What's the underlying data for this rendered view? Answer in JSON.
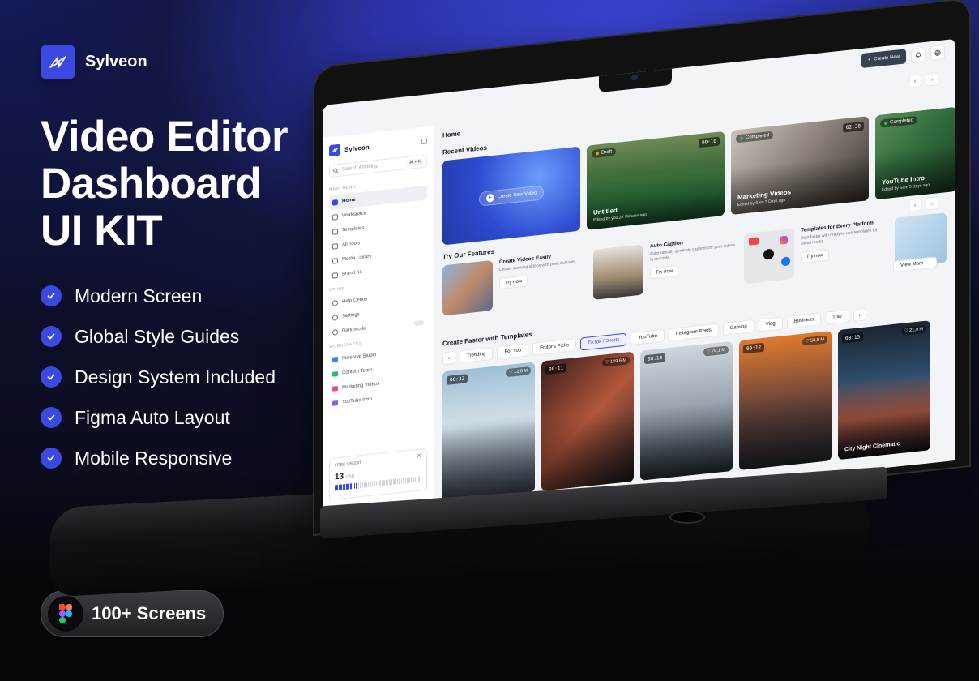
{
  "brand": {
    "name": "Sylveon"
  },
  "hero": {
    "line1": "Video Editor",
    "line2": "Dashboard",
    "line3": "UI KIT"
  },
  "features": [
    "Modern Screen",
    "Global Style Guides",
    "Design System Included",
    "Figma Auto Layout",
    "Mobile Responsive"
  ],
  "badge": {
    "label": "100+ Screens"
  },
  "app": {
    "topbar": {
      "create_label": "Create New",
      "bell_icon": "bell-icon",
      "globe_icon": "globe-icon"
    },
    "sidebar": {
      "brand": "Sylveon",
      "search_placeholder": "Search Anything",
      "search_shortcut": "⌘ + K",
      "main_menu_label": "MAIN MENU",
      "main_items": [
        "Home",
        "Workspace",
        "Templates",
        "All Tools",
        "Media Library",
        "Brand Kit"
      ],
      "other_label": "OTHER",
      "other_items": [
        "Help Center",
        "Settings",
        "Dark Mode"
      ],
      "workspaces_label": "WORKSPACES",
      "workspaces": [
        {
          "name": "Personal Studio",
          "color": "#3b82f6"
        },
        {
          "name": "Content Team",
          "color": "#22c55e"
        },
        {
          "name": "Marketing Videos",
          "color": "#ec4899"
        },
        {
          "name": "YouTube Intro",
          "color": "#8b5cf6"
        }
      ],
      "credit": {
        "label": "FREE CREDIT",
        "used": "13",
        "total": "/ 50",
        "fraction": 0.26
      }
    },
    "main": {
      "page_title": "Home",
      "recent_title": "Recent Videos",
      "new_video_label": "Create New Video",
      "recent": [
        {
          "badge": "Draft",
          "badge_color": "#f59e0b",
          "time": "00:10",
          "title": "Untitled",
          "sub": "Edited by you 20 Minutes ago"
        },
        {
          "badge": "Completed",
          "badge_color": "#22c55e",
          "time": "02:38",
          "title": "Marketing Videos",
          "sub": "Edited by Sam 3 Days ago"
        },
        {
          "badge": "Completed",
          "badge_color": "#22c55e",
          "time": "",
          "title": "YouTube Intro",
          "sub": "Edited by Sam 5 Days ago"
        }
      ],
      "features_title": "Try Our Features",
      "feature_cards": [
        {
          "title": "Create Videos Easily",
          "desc": "Create stunning videos with powerful tools.",
          "cta": "Try now"
        },
        {
          "title": "Auto Caption",
          "desc": "Automatically generate captions for your videos in seconds.",
          "cta": "Try now"
        },
        {
          "title": "Templates for Every Platform",
          "desc": "Start faster with ready-to-use templates for social media.",
          "cta": "Try now"
        }
      ],
      "view_more": "View More",
      "templates_title": "Create Faster with Templates",
      "chips": [
        "Trending",
        "For You",
        "Editor's Picks",
        "TikTok / Shorts",
        "YouTube",
        "Instagram Reels",
        "Gaming",
        "Vlog",
        "Business",
        "Trav"
      ],
      "active_chip": "TikTok / Shorts",
      "templates": [
        {
          "time": "00:32",
          "likes": "12,5 M",
          "title": ""
        },
        {
          "time": "00:11",
          "likes": "149,6 M",
          "title": ""
        },
        {
          "time": "00:10",
          "likes": "78,1 M",
          "title": ""
        },
        {
          "time": "00:12",
          "likes": "58,5 M",
          "title": ""
        },
        {
          "time": "00:15",
          "likes": "21,9 M",
          "title": "City Night Cinematic"
        }
      ]
    }
  },
  "colors": {
    "accent": "#3b49e0",
    "dark_button": "#374151"
  }
}
